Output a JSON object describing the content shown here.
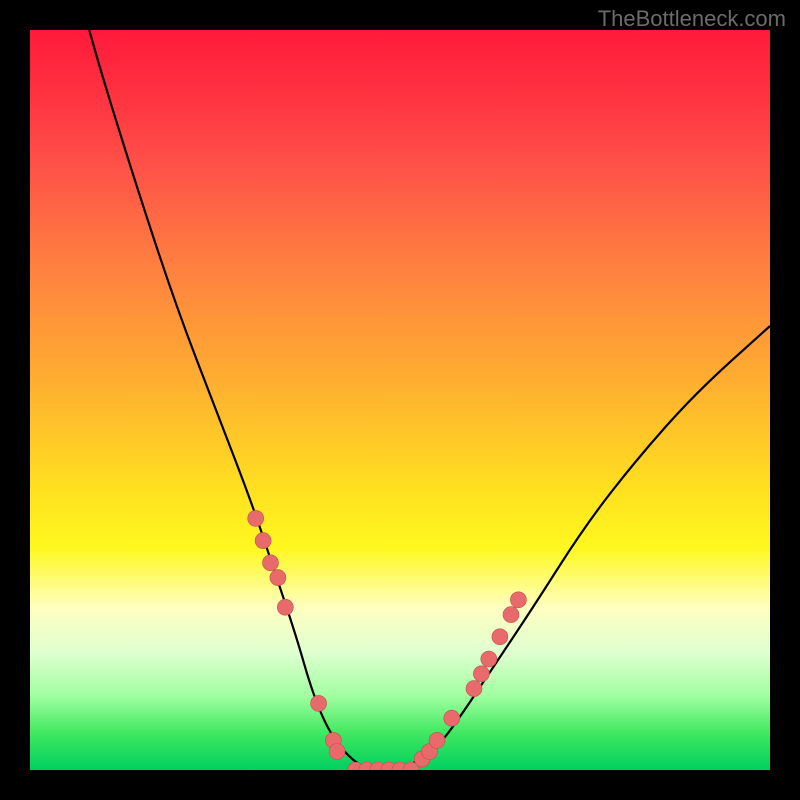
{
  "watermark": "TheBottleneck.com",
  "chart_data": {
    "type": "line",
    "title": "",
    "xlabel": "",
    "ylabel": "",
    "xlim": [
      0,
      100
    ],
    "ylim": [
      0,
      100
    ],
    "curve": {
      "name": "bottleneck-curve",
      "x": [
        8,
        10,
        15,
        20,
        25,
        30,
        33,
        36,
        38,
        40,
        42,
        44,
        46,
        48,
        50,
        52,
        55,
        58,
        62,
        68,
        75,
        82,
        90,
        100
      ],
      "y": [
        100,
        93,
        77,
        62,
        49,
        36,
        27,
        18,
        11,
        6,
        3,
        1,
        0,
        0,
        0,
        1,
        3,
        7,
        13,
        22,
        33,
        42,
        51,
        60
      ]
    },
    "markers_left": {
      "name": "left-points",
      "x": [
        30.5,
        31.5,
        32.5,
        33.5,
        34.5,
        39,
        41,
        41.5
      ],
      "y": [
        34,
        31,
        28,
        26,
        22,
        9,
        4,
        2.5
      ]
    },
    "markers_right": {
      "name": "right-points",
      "x": [
        53,
        54,
        55,
        57,
        60,
        61,
        62,
        63.5,
        65,
        66
      ],
      "y": [
        1.5,
        2.5,
        4,
        7,
        11,
        13,
        15,
        18,
        21,
        23
      ]
    },
    "markers_bottom": {
      "name": "bottom-points",
      "x": [
        44,
        45.5,
        47,
        48.5,
        50,
        51.5
      ],
      "y": [
        0,
        0,
        0,
        0,
        0,
        0
      ]
    },
    "colors": {
      "curve": "#000000",
      "marker_fill": "#e86a6a",
      "marker_stroke": "#c05050"
    }
  }
}
